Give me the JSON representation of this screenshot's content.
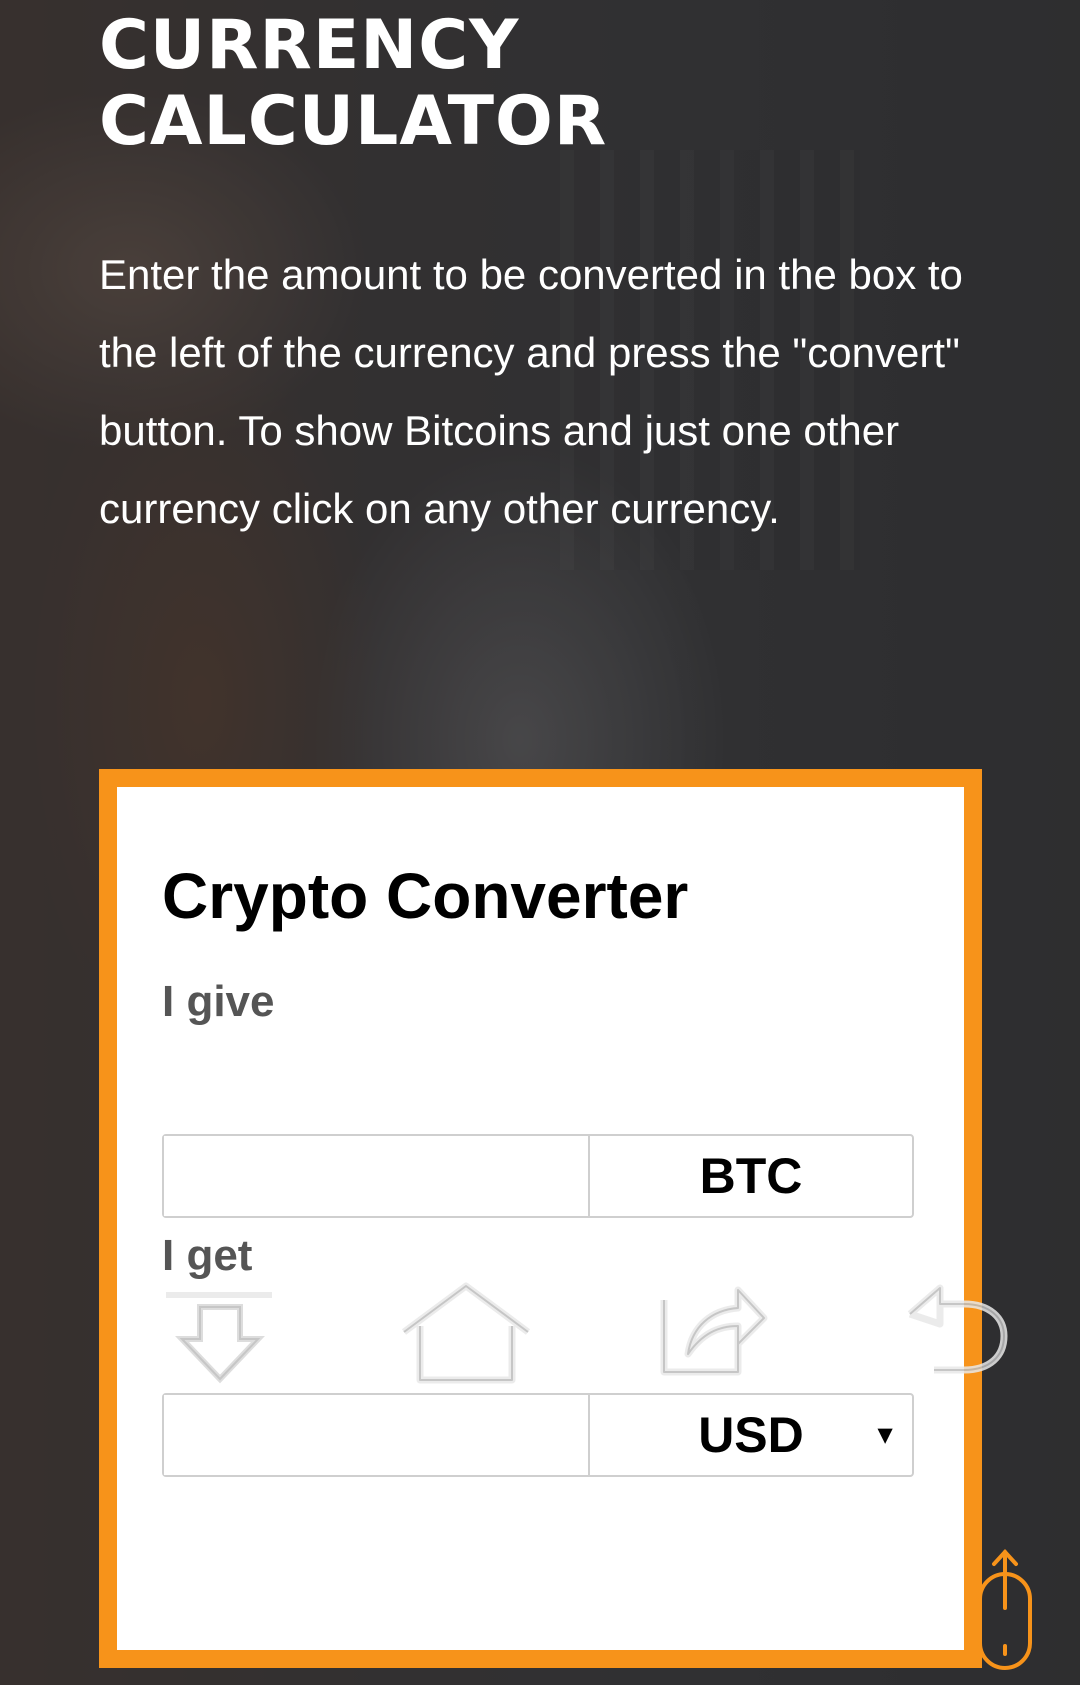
{
  "hero": {
    "title_line1": "CURRENCY",
    "title_line2": "CALCULATOR",
    "description": "Enter the amount to be converted in the box to the left of the currency and press the \"convert\" button. To show Bitcoins and just one other currency click on any other currency."
  },
  "converter": {
    "title": "Crypto Converter",
    "give_label": "I give",
    "give_value": "",
    "give_currency": "BTC",
    "get_label": "I get",
    "get_value": "",
    "get_currency": "USD",
    "get_caret": "▼"
  },
  "colors": {
    "accent": "#f7931a",
    "card_bg": "#ffffff",
    "label_gray": "#555555"
  },
  "overlay_icons": [
    "download-icon",
    "home-icon",
    "share-icon",
    "back-icon",
    "scroll-up-icon"
  ]
}
